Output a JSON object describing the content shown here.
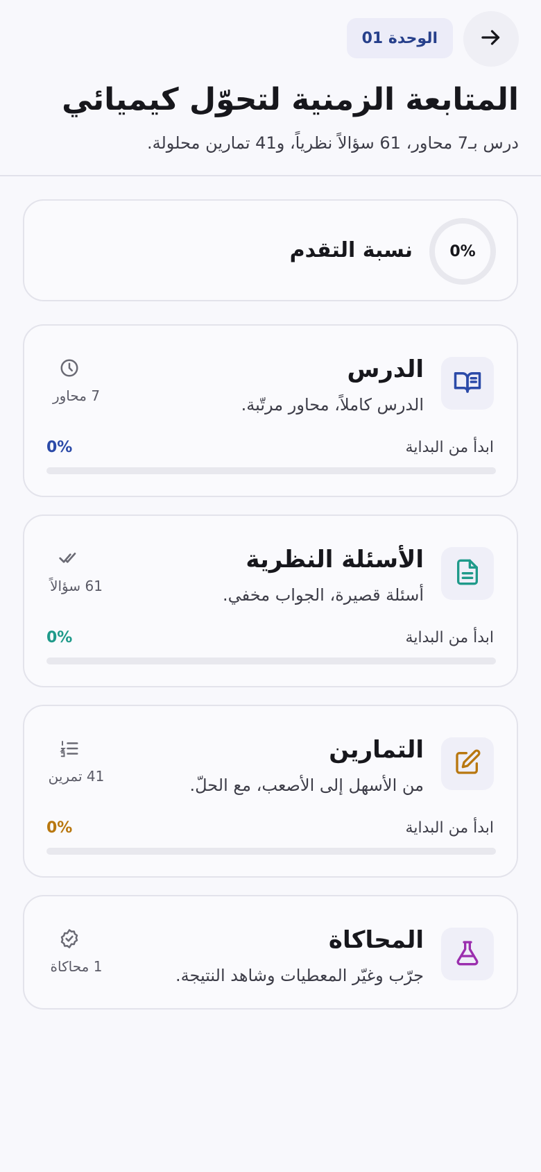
{
  "header": {
    "unit_badge": "الوحدة 01",
    "title": "المتابعة الزمنية لتحوّل كيميائي",
    "subtitle": "درس بـ7 محاور، 61 سؤالاً نظرياً، و41 تمارين محلولة."
  },
  "overall_progress": {
    "label": "نسبة التقدم",
    "value_text": "0%",
    "value": 0
  },
  "sections": [
    {
      "title": "الدرس",
      "description": "الدرس كاملاً، محاور مرتّبة.",
      "icon": "book-open-icon",
      "meta_icon": "clock-icon",
      "meta": "7 محاور",
      "start_label": "ابدأ من البداية",
      "percent_text": "0%",
      "progress": 0,
      "color": "#2b4aa8"
    },
    {
      "title": "الأسئلة النظرية",
      "description": "أسئلة قصيرة، الجواب مخفي.",
      "icon": "document-text-icon",
      "meta_icon": "double-check-icon",
      "meta": "61 سؤالاً",
      "start_label": "ابدأ من البداية",
      "percent_text": "0%",
      "progress": 0,
      "color": "#1f9a8a"
    },
    {
      "title": "التمارين",
      "description": "من الأسهل إلى الأصعب، مع الحلّ.",
      "icon": "edit-square-icon",
      "meta_icon": "numbered-list-icon",
      "meta": "41 تمرين",
      "start_label": "ابدأ من البداية",
      "percent_text": "0%",
      "progress": 0,
      "color": "#b8770f"
    },
    {
      "title": "المحاكاة",
      "description": "جرّب وغيّر المعطيات وشاهد النتيجة.",
      "icon": "flask-icon",
      "meta_icon": "verified-badge-icon",
      "meta": "1 محاكاة",
      "color": "#9b2fae"
    }
  ]
}
